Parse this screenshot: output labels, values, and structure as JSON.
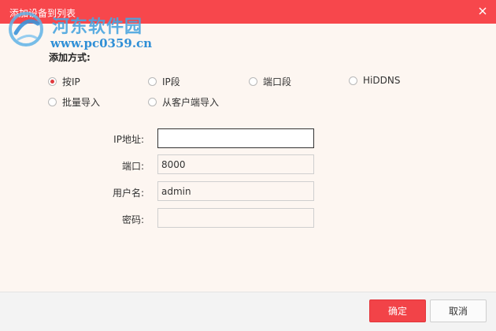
{
  "window": {
    "title": "添加设备到列表"
  },
  "watermark": {
    "title": "河东软件园",
    "url": "www.pc0359.cn"
  },
  "add_method": {
    "label": "添加方式:",
    "options": [
      {
        "label": "按IP",
        "checked": true
      },
      {
        "label": "IP段",
        "checked": false
      },
      {
        "label": "端口段",
        "checked": false
      },
      {
        "label": "HiDDNS",
        "checked": false
      },
      {
        "label": "批量导入",
        "checked": false
      },
      {
        "label": "从客户端导入",
        "checked": false
      }
    ]
  },
  "form": {
    "ip": {
      "label": "IP地址:",
      "value": ""
    },
    "port": {
      "label": "端口:",
      "value": "8000"
    },
    "username": {
      "label": "用户名:",
      "value": "admin"
    },
    "password": {
      "label": "密码:",
      "value": ""
    }
  },
  "buttons": {
    "ok": "确定",
    "cancel": "取消"
  },
  "colors": {
    "accent": "#f7474c",
    "background": "#fdf6f1"
  }
}
